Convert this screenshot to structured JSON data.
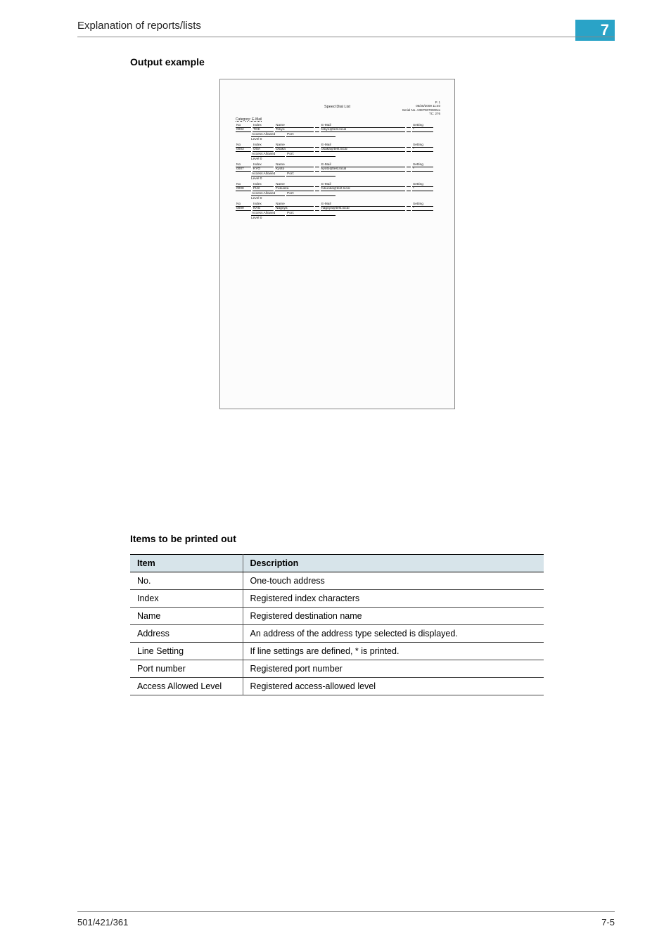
{
  "header": {
    "title": "Explanation of reports/lists",
    "chapter": "7"
  },
  "sections": {
    "output_example": "Output example",
    "items_heading": "Items to be printed out"
  },
  "items_table": {
    "head": {
      "item": "Item",
      "desc": "Description"
    },
    "rows": [
      {
        "item": "No.",
        "desc": "One-touch address"
      },
      {
        "item": "Index",
        "desc": "Registered index characters"
      },
      {
        "item": "Name",
        "desc": "Registered destination name"
      },
      {
        "item": "Address",
        "desc": "An address of the address type selected is displayed."
      },
      {
        "item": "Line Setting",
        "desc": "If line settings are defined, * is printed."
      },
      {
        "item": "Port number",
        "desc": "Registered port number"
      },
      {
        "item": "Access Allowed Level",
        "desc": "Registered access-allowed level"
      }
    ]
  },
  "report_preview": {
    "title": "Speed Dial List",
    "meta": {
      "page": "P.  1",
      "date_time": "06/25/2009  11:40",
      "serial_label": "Serial No.",
      "serial": "A0EP0070000xx",
      "tc_label": "TC:",
      "tc": "276"
    },
    "category": "Category: E-Mail",
    "head": {
      "no": "No",
      "index": "Index",
      "name": "Name",
      "email": "E-Mail",
      "setting": "Setting"
    },
    "sub_labels": {
      "access": "Access Allowed",
      "port": "Port"
    },
    "entries": [
      {
        "no": "0002",
        "index": "TOK",
        "name": "Tokyo",
        "email": "tokyo@test.local",
        "setting": "*",
        "port": "",
        "level": "Level 0"
      },
      {
        "no": "0003",
        "index": "OSA",
        "name": "Osaka",
        "email": "osaka@test.local",
        "setting": "*",
        "port": "",
        "level": "Level 0"
      },
      {
        "no": "0007",
        "index": "KYO",
        "name": "Kyoto",
        "email": "kyoto@test.local",
        "setting": "*",
        "port": "",
        "level": "Level 0"
      },
      {
        "no": "0008",
        "index": "FUK",
        "name": "Fukuoka",
        "email": "fukuoka@test.local",
        "setting": "*",
        "port": "",
        "level": "Level 0"
      },
      {
        "no": "0009",
        "index": "NAG",
        "name": "Nagoya",
        "email": "nagoya@test.local",
        "setting": "*",
        "port": "",
        "level": "Level 0"
      }
    ]
  },
  "footer": {
    "left": "501/421/361",
    "right": "7-5"
  }
}
